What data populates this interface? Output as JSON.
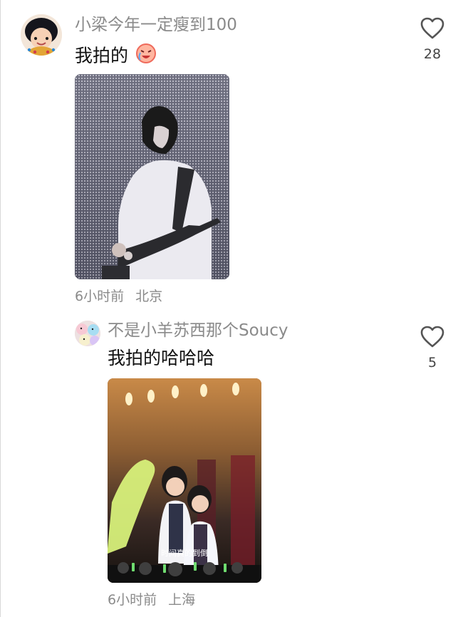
{
  "comments": [
    {
      "username": "小梁今年一定瘦到100",
      "text": "我拍的",
      "emoji_icon": "crying-laughing-emoji",
      "time": "6小时前",
      "location": "北京",
      "likes": "28",
      "avatar_icon": "cartoon-girl-avatar",
      "photo_icon": "concert-bassist-photo"
    },
    {
      "username": "不是小羊苏西那个Soucy",
      "text": "我拍的哈哈哈",
      "time": "6小时前",
      "location": "上海",
      "likes": "5",
      "avatar_icon": "plush-toys-avatar",
      "photo_icon": "concert-stage-photo",
      "photo_caption": "时间真的到倒"
    }
  ],
  "colors": {
    "meta_gray": "#8a8a8a",
    "text": "#111111"
  }
}
